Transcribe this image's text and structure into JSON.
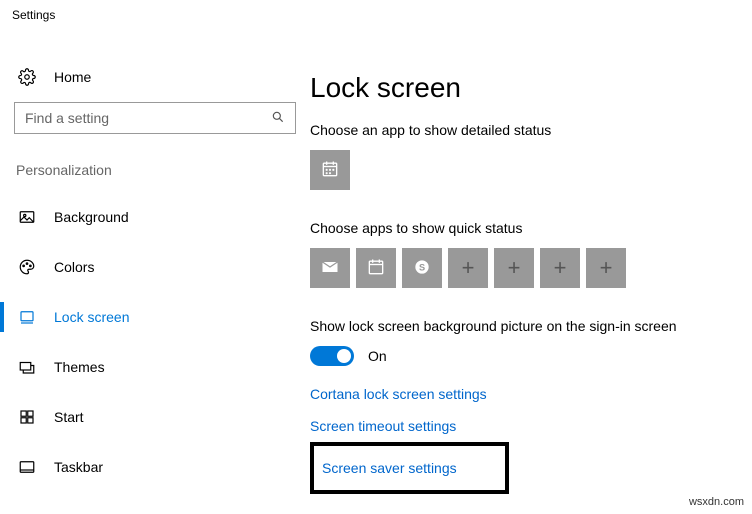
{
  "window_title": "Settings",
  "sidebar": {
    "home_label": "Home",
    "search_placeholder": "Find a setting",
    "section_label": "Personalization",
    "items": [
      {
        "label": "Background"
      },
      {
        "label": "Colors"
      },
      {
        "label": "Lock screen"
      },
      {
        "label": "Themes"
      },
      {
        "label": "Start"
      },
      {
        "label": "Taskbar"
      }
    ]
  },
  "main": {
    "title": "Lock screen",
    "detailed_status_heading": "Choose an app to show detailed status",
    "quick_status_heading": "Choose apps to show quick status",
    "signin_bg_label": "Show lock screen background picture on the sign-in screen",
    "toggle_state": "On",
    "links": {
      "cortana": "Cortana lock screen settings",
      "timeout": "Screen timeout settings",
      "saver": "Screen saver settings"
    }
  },
  "watermark": "wsxdn.com"
}
